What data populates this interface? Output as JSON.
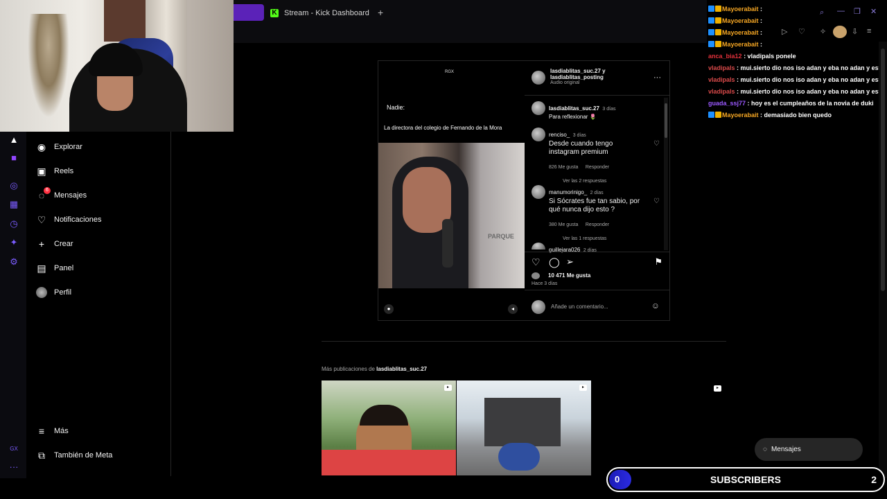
{
  "browser": {
    "tab_title": "Stream - Kick Dashboard",
    "new_tab": "+"
  },
  "sidebar": {
    "items": [
      {
        "label": "Explorar",
        "icon": "compass-icon"
      },
      {
        "label": "Reels",
        "icon": "reels-icon"
      },
      {
        "label": "Mensajes",
        "icon": "messenger-icon",
        "badge": "6"
      },
      {
        "label": "Notificaciones",
        "icon": "heart-icon"
      },
      {
        "label": "Crear",
        "icon": "plus-icon"
      },
      {
        "label": "Panel",
        "icon": "chart-icon"
      },
      {
        "label": "Perfil",
        "icon": "avatar-icon"
      }
    ],
    "more": "Más",
    "meta": "También de Meta"
  },
  "post": {
    "media": {
      "watermark": "RGX",
      "line1": "Nadie:",
      "caption": "La directora del colegio de Fernando de la Mora",
      "sign_text": "PARQUE"
    },
    "header": {
      "authors": "lasdiablitas_suc.27 y lasdiablitas_posting",
      "audio": "Audio original",
      "more": "···"
    },
    "comments": [
      {
        "user": "lasdiablitas_suc.27",
        "age": "3 días",
        "text": "Para reflexionar 🌷",
        "likes": "",
        "reply": "",
        "view": ""
      },
      {
        "user": "renciso_",
        "age": "3 días",
        "text": "Desde cuando tengo instagram premium",
        "likes": "826 Me gusta",
        "reply": "Responder",
        "view": "Ver las 2 respuestas"
      },
      {
        "user": "manumorinigo_",
        "age": "2 días",
        "text": "Si Sócrates fue tan sabio, por qué nunca dijo esto ?",
        "likes": "380 Me gusta",
        "reply": "Responder",
        "view": "Ver las 1 respuestas"
      },
      {
        "user": "guillejara026",
        "age": "2 días",
        "text": "",
        "likes": "",
        "reply": "",
        "view": ""
      }
    ],
    "likes": "10 471 Me gusta",
    "time": "Hace 3 días",
    "add_comment_placeholder": "Añade un comentario..."
  },
  "more_posts": {
    "prefix": "Más publicaciones de",
    "user": "lasdiablitas_suc.27"
  },
  "chat": [
    {
      "user": "Mayoerabait",
      "color": "#f5a623",
      "msg": ":"
    },
    {
      "user": "Mayoerabait",
      "color": "#f5a623",
      "msg": ":"
    },
    {
      "user": "Mayoerabait",
      "color": "#f5a623",
      "msg": ":"
    },
    {
      "user": "Mayoerabait",
      "color": "#f5a623",
      "msg": ":"
    },
    {
      "user": "anca_bia12",
      "color": "#e0303a",
      "msg": ": vladipals ponele"
    },
    {
      "user": "vladipals",
      "color": "#d94a4a",
      "msg": ": mui.sierto dio nos iso adan y eba no adan y estel"
    },
    {
      "user": "vladipals",
      "color": "#d94a4a",
      "msg": ": mui.sierto dio nos iso adan y eba no adan y estel"
    },
    {
      "user": "vladipals",
      "color": "#d94a4a",
      "msg": ": mui.sierto dio nos iso adan y eba no adan y estel"
    },
    {
      "user": "guada_ssj77",
      "color": "#9b59ff",
      "msg": ": hoy es el cumpleaños de la novia de duki"
    },
    {
      "user": "Mayoerabait",
      "color": "#f5a623",
      "msg": ": demasiado bien quedo"
    }
  ],
  "messages_pill": "Mensajes",
  "subscribers": {
    "count": "0",
    "label": "SUBSCRIBERS",
    "goal": "2"
  },
  "strip": {
    "gx": "GX",
    "dots": "···"
  }
}
